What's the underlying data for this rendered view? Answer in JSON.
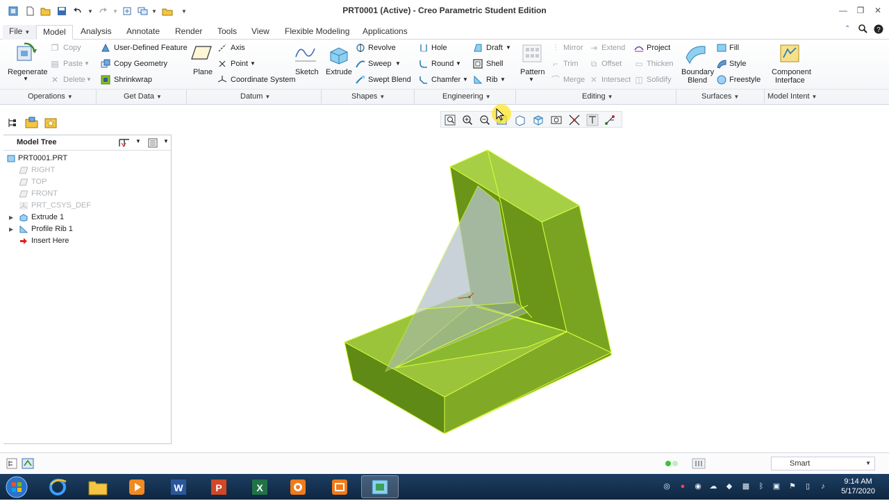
{
  "window": {
    "title": "PRT0001 (Active) - Creo Parametric Student Edition"
  },
  "tabs": [
    {
      "label": "File"
    },
    {
      "label": "Model"
    },
    {
      "label": "Analysis"
    },
    {
      "label": "Annotate"
    },
    {
      "label": "Render"
    },
    {
      "label": "Tools"
    },
    {
      "label": "View"
    },
    {
      "label": "Flexible Modeling"
    },
    {
      "label": "Applications"
    }
  ],
  "ribbon": {
    "operations": {
      "regenerate": "Regenerate",
      "copy": "Copy",
      "paste": "Paste",
      "delete": "Delete",
      "group": "Operations"
    },
    "get_data": {
      "udf": "User-Defined Feature",
      "copy_geometry": "Copy Geometry",
      "shrinkwrap": "Shrinkwrap",
      "group": "Get Data"
    },
    "datum": {
      "plane": "Plane",
      "axis": "Axis",
      "point": "Point",
      "csys": "Coordinate System",
      "sketch": "Sketch",
      "group": "Datum"
    },
    "shapes": {
      "extrude": "Extrude",
      "revolve": "Revolve",
      "sweep": "Sweep",
      "swept_blend": "Swept Blend",
      "group": "Shapes"
    },
    "engineering": {
      "hole": "Hole",
      "round": "Round",
      "chamfer": "Chamfer",
      "draft": "Draft",
      "shell": "Shell",
      "rib": "Rib",
      "group": "Engineering"
    },
    "editing": {
      "pattern": "Pattern",
      "mirror": "Mirror",
      "trim": "Trim",
      "merge": "Merge",
      "extend": "Extend",
      "offset": "Offset",
      "intersect": "Intersect",
      "project": "Project",
      "thicken": "Thicken",
      "solidify": "Solidify",
      "group": "Editing"
    },
    "surfaces": {
      "boundary_blend_1": "Boundary",
      "boundary_blend_2": "Blend",
      "fill": "Fill",
      "style": "Style",
      "freestyle": "Freestyle",
      "group": "Surfaces"
    },
    "model_intent": {
      "component_interface_1": "Component",
      "component_interface_2": "Interface",
      "group": "Model Intent"
    }
  },
  "model_tree": {
    "title": "Model Tree",
    "items": [
      {
        "label": "PRT0001.PRT"
      },
      {
        "label": "RIGHT"
      },
      {
        "label": "TOP"
      },
      {
        "label": "FRONT"
      },
      {
        "label": "PRT_CSYS_DEF"
      },
      {
        "label": "Extrude 1"
      },
      {
        "label": "Profile Rib 1"
      },
      {
        "label": "Insert Here"
      }
    ]
  },
  "statusbar": {
    "filter": "Smart"
  },
  "taskbar": {
    "time": "9:14 AM",
    "date": "5/17/2020"
  },
  "colors": {
    "accent": "#3a6db0",
    "model_green": "#8fbd2c",
    "edge": "#d8ff3a"
  }
}
